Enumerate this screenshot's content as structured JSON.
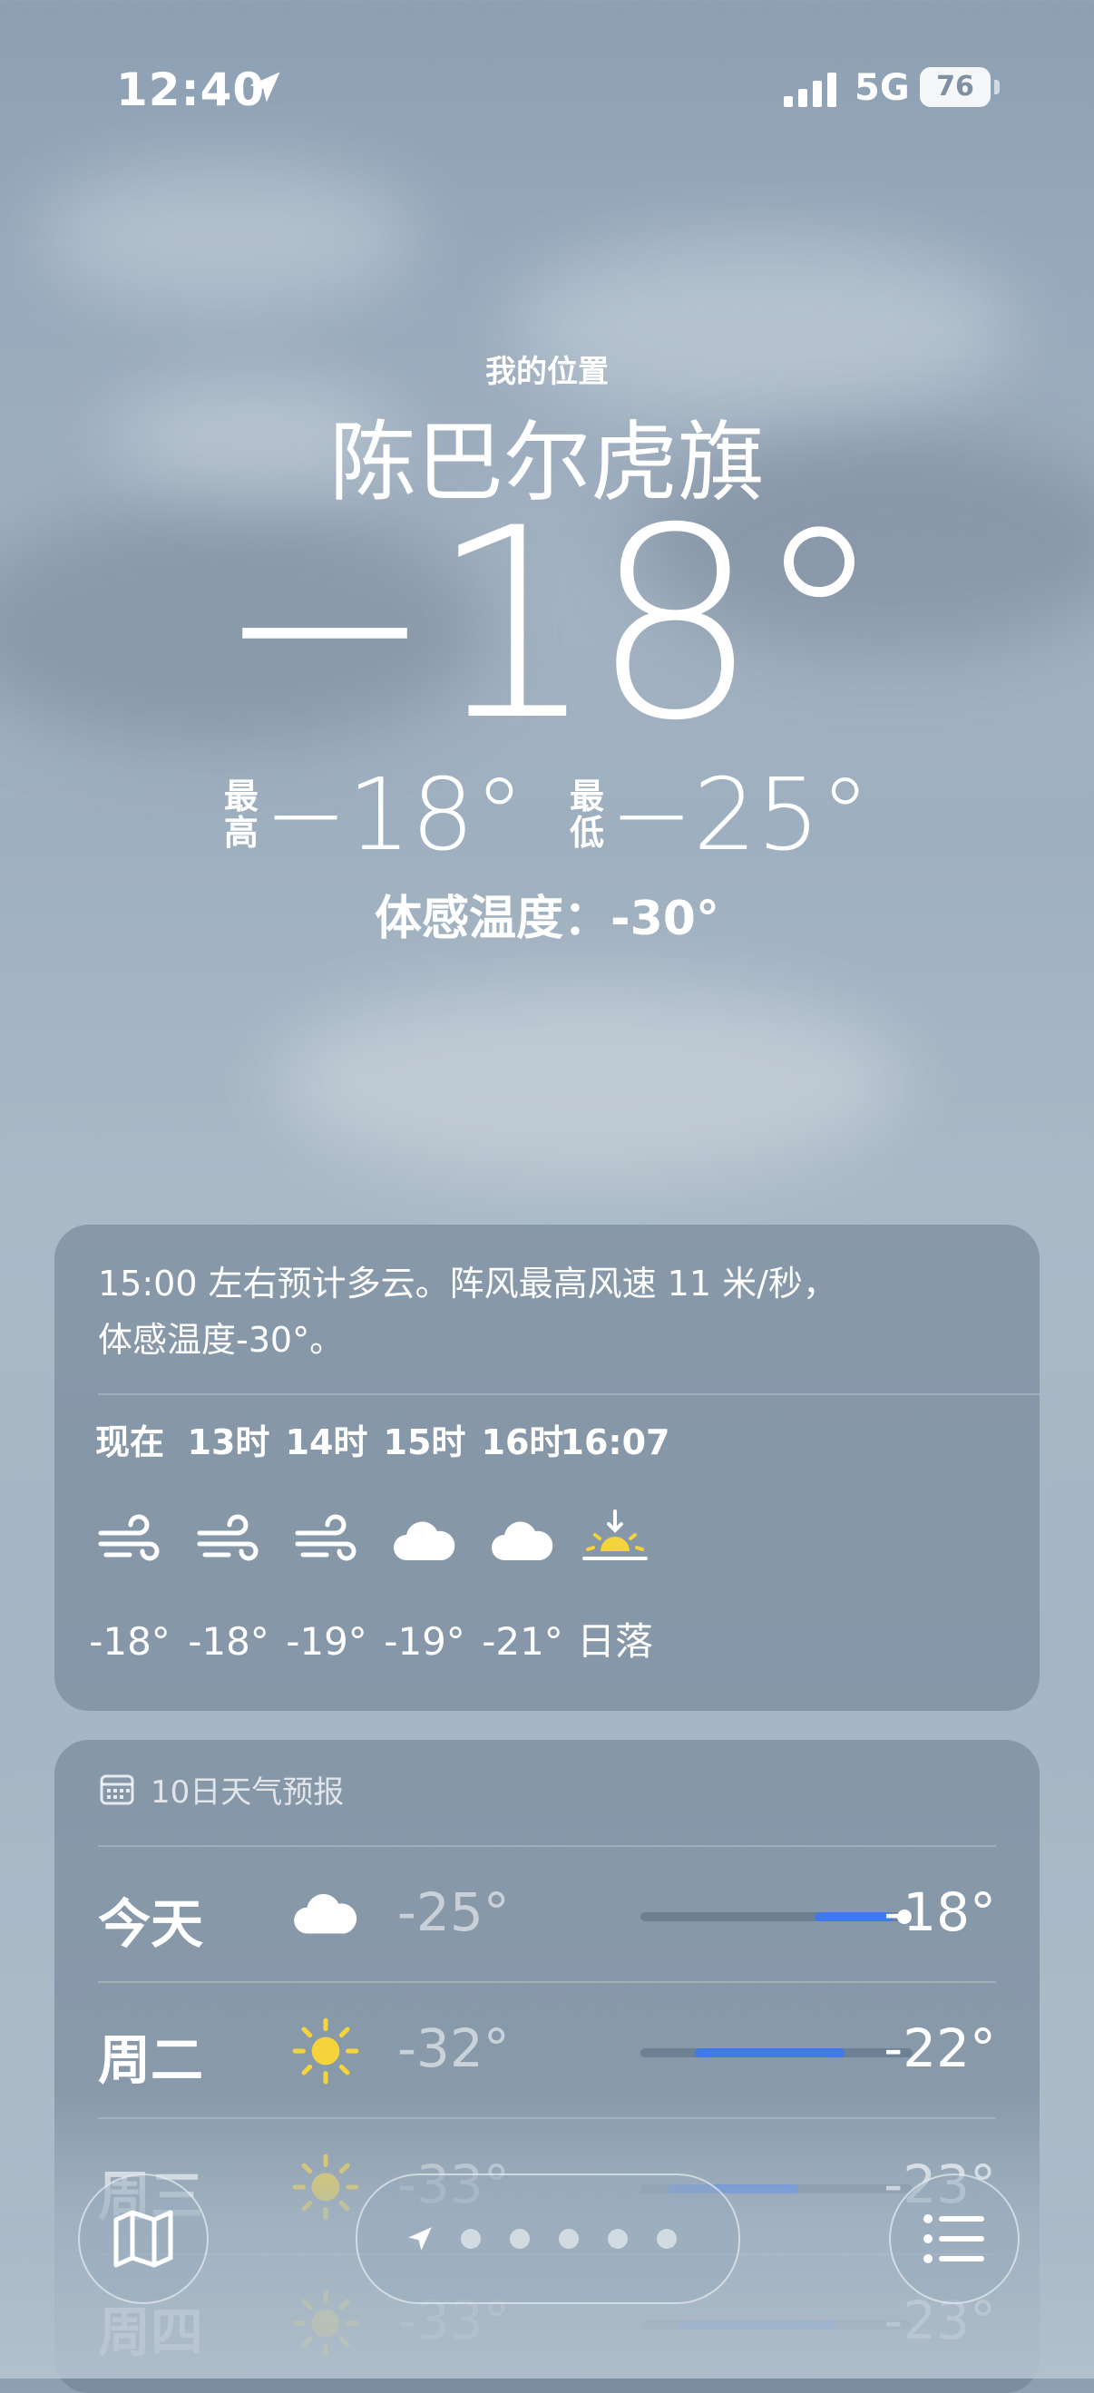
{
  "status_bar": {
    "time": "12:40",
    "network": "5G",
    "battery": "76"
  },
  "header": {
    "location_label": "我的位置",
    "city": "陈巴尔虎旗",
    "temperature": "−18°",
    "high_label_1": "最",
    "high_label_2": "高",
    "high_value": "−18°",
    "low_label_1": "最",
    "low_label_2": "低",
    "low_value": "−25°",
    "feels_like": "体感温度：-30°"
  },
  "hourly": {
    "summary_line1": "15:00 左右预计多云。阵风最高风速 11 米/秒，",
    "summary_line2": "体感温度-30°。",
    "hours": [
      {
        "label": "现在",
        "icon": "wind-icon",
        "temp": "-18°"
      },
      {
        "label": "13时",
        "icon": "wind-icon",
        "temp": "-18°"
      },
      {
        "label": "14时",
        "icon": "wind-icon",
        "temp": "-19°"
      },
      {
        "label": "15时",
        "icon": "cloud-icon",
        "temp": "-19°"
      },
      {
        "label": "16时",
        "icon": "cloud-icon",
        "temp": "-21°"
      },
      {
        "label": "16:07",
        "icon": "sunset-icon",
        "temp": "日落"
      }
    ]
  },
  "daily": {
    "title": "10日天气预报",
    "days": [
      {
        "name": "今天",
        "icon": "cloud-icon",
        "low": "-25°",
        "high": "-18°",
        "bar_start": 0.64,
        "bar_end": 0.93,
        "current": 0.97
      },
      {
        "name": "周二",
        "icon": "sun-icon",
        "low": "-32°",
        "high": "-22°",
        "bar_start": 0.2,
        "bar_end": 0.75
      },
      {
        "name": "周三",
        "icon": "sun-icon",
        "low": "-33°",
        "high": "-23°",
        "bar_start": 0.1,
        "bar_end": 0.58
      },
      {
        "name": "周四",
        "icon": "sun-icon",
        "low": "-33°",
        "high": "-23°",
        "bar_start": 0.14,
        "bar_end": 0.72
      }
    ]
  },
  "colors": {
    "range_bar": "#3f79ea",
    "sun": "#f5d33a"
  }
}
